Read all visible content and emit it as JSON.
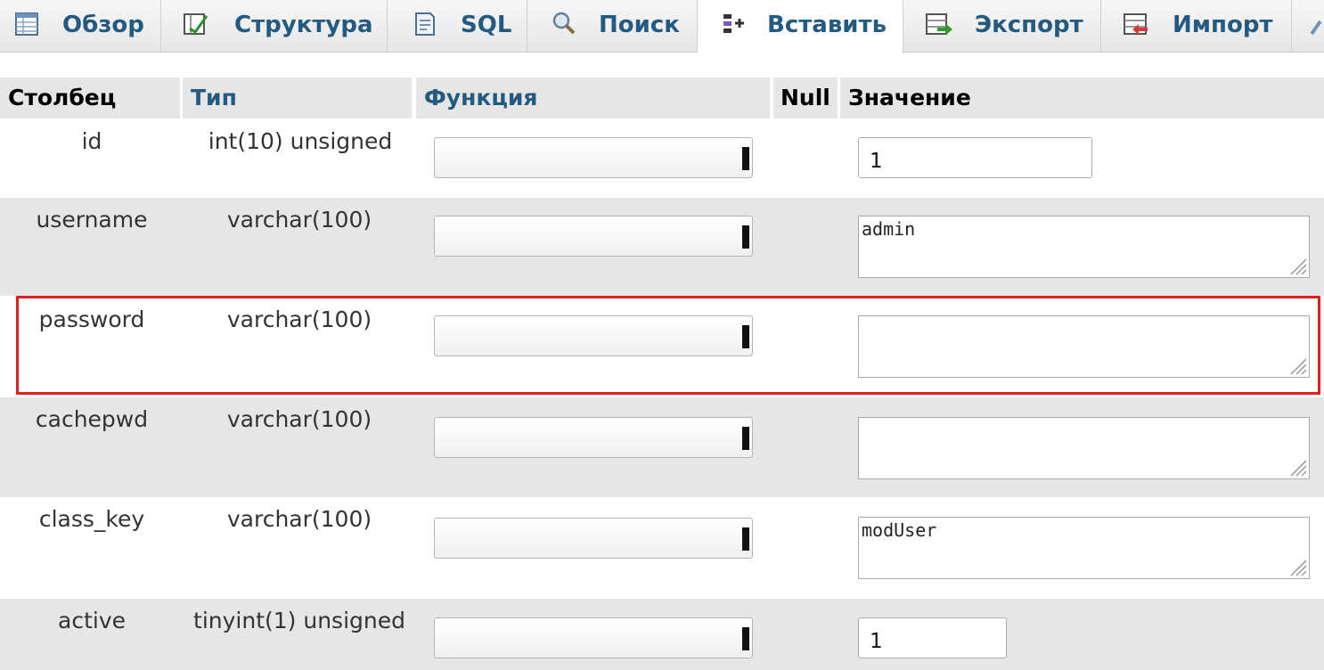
{
  "tabs": [
    {
      "label": "Обзор",
      "icon": "browse-table-icon"
    },
    {
      "label": "Структура",
      "icon": "structure-icon"
    },
    {
      "label": "SQL",
      "icon": "sql-document-icon"
    },
    {
      "label": "Поиск",
      "icon": "magnifier-icon"
    },
    {
      "label": "Вставить",
      "icon": "insert-row-icon",
      "active": true
    },
    {
      "label": "Экспорт",
      "icon": "export-icon"
    },
    {
      "label": "Импорт",
      "icon": "import-icon"
    }
  ],
  "table_header": {
    "column": "Столбец",
    "type": "Тип",
    "function": "Функция",
    "null": "Null",
    "value": "Значение"
  },
  "rows": [
    {
      "column": "id",
      "type": "int(10) unsigned",
      "function": "",
      "value": "1",
      "input": "text"
    },
    {
      "column": "username",
      "type": "varchar(100)",
      "function": "",
      "value": "admin",
      "input": "textarea"
    },
    {
      "column": "password",
      "type": "varchar(100)",
      "function": "",
      "value": "",
      "input": "textarea",
      "highlighted": true
    },
    {
      "column": "cachepwd",
      "type": "varchar(100)",
      "function": "",
      "value": "",
      "input": "textarea"
    },
    {
      "column": "class_key",
      "type": "varchar(100)",
      "function": "",
      "value": "modUser",
      "input": "textarea"
    },
    {
      "column": "active",
      "type": "tinyint(1) unsigned",
      "function": "",
      "value": "1",
      "input": "text"
    }
  ],
  "colors": {
    "link_blue": "#235a81",
    "row_shade": "#e6e6e6",
    "highlight_red": "#e02020"
  }
}
